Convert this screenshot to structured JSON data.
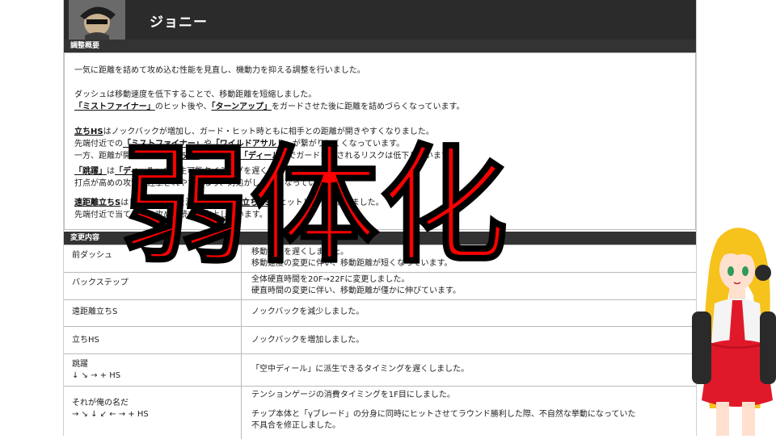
{
  "character": {
    "name": "ジョニー"
  },
  "summary_section": {
    "title": "調整概要",
    "paragraphs": [
      [
        "一気に距離を詰めて攻め込む性能を見直し、機動力を抑える調整を行いました。"
      ],
      [
        "ダッシュは移動速度を低下することで、移動距離を短縮しました。",
        "「ミストファイナー」のヒット後や、「ターンアップ」をガードさせた後に距離を詰めづらくなっています。"
      ],
      [
        "立ちHSはノックバックが増加し、ガード・ヒット時ともに相手との距離が開きやすくなりました。",
        "先端付近での「ミストファイナー」や「ワイルドアサルト」が繋がりにくくなっています。",
        "一方、距離が開くことで、立ちHSガード後に「ディール」でガードを崩されるリスクは低下しています。"
      ],
      [
        "「跳躍」は「ディール」の派生可能タイミングを遅くしました。",
        "打点が高めの攻撃で迎撃されやすくなり、対処がしやすくなっています。"
      ],
      [
        "遠距離立ちSはヒットバックを減少させ、続く立ちHSがヒットしやすくなりました。",
        "先端付近で当てた際の攻め継続力が向上しています。"
      ]
    ]
  },
  "changes_section": {
    "title": "変更内容",
    "rows": [
      {
        "move": "前ダッシュ",
        "notation": "",
        "details": [
          "移動速度を遅くしました。",
          "移動速度の変更に伴い、移動距離が短くなっています。"
        ]
      },
      {
        "move": "バックステップ",
        "notation": "",
        "details": [
          "全体硬直時間を20F→22Fに変更しました。",
          "硬直時間の変更に伴い、移動距離が僅かに伸びています。"
        ]
      },
      {
        "move": "遠距離立ちS",
        "notation": "",
        "details": [
          "ノックバックを減少しました。"
        ]
      },
      {
        "move": "立ちHS",
        "notation": "",
        "details": [
          "ノックバックを増加しました。"
        ]
      },
      {
        "move": "跳躍",
        "notation": "↓ ↘ → + HS",
        "details": [
          "「空中ディール」に派生できるタイミングを遅くしました。"
        ]
      },
      {
        "move": "それが俺の名だ",
        "notation": "→ ↘ ↓ ↙ ← → + HS",
        "details": [
          "テンションゲージの消費タイミングを1F目にしました。",
          "",
          "チップ本体と「γブレード」の分身に同時にヒットさせてラウンド勝利した際、不自然な挙動になっていた",
          "不具合を修正しました。"
        ]
      }
    ]
  },
  "overlay": {
    "stamp_text": "弱体化"
  },
  "colors": {
    "header_bg": "#2b2b2b",
    "stamp": "#ff0000",
    "avatar_hair": "#f6c21c",
    "avatar_outfit": "#e0192a"
  },
  "icons": {
    "portrait": "character-portrait-icon",
    "avatar": "vtuber-avatar-icon"
  }
}
